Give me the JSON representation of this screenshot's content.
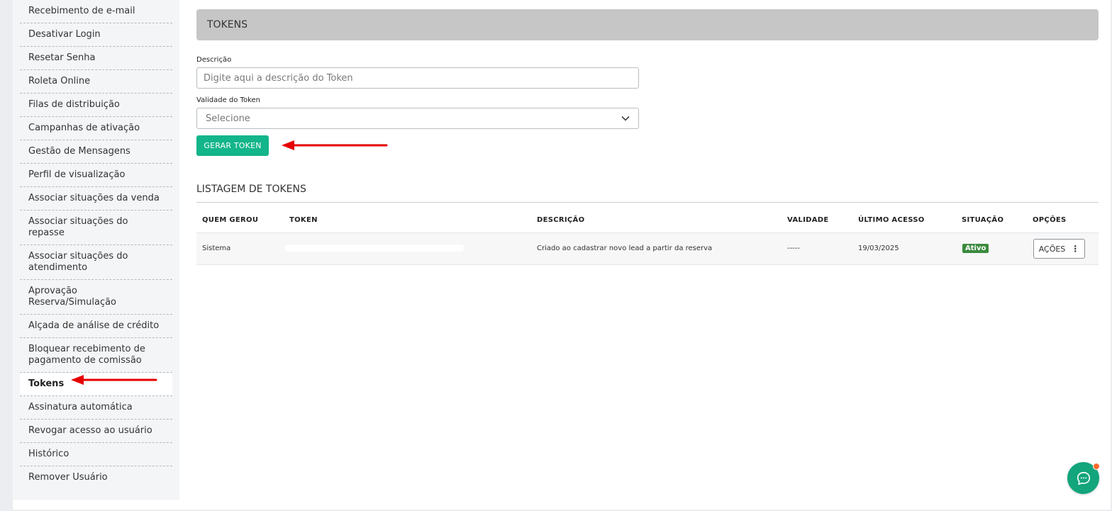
{
  "sidebar": {
    "items": [
      {
        "label": "Recebimento de e-mail",
        "active": false
      },
      {
        "label": "Desativar Login",
        "active": false
      },
      {
        "label": "Resetar Senha",
        "active": false
      },
      {
        "label": "Roleta Online",
        "active": false
      },
      {
        "label": "Filas de distribuição",
        "active": false
      },
      {
        "label": "Campanhas de ativação",
        "active": false
      },
      {
        "label": "Gestão de Mensagens",
        "active": false
      },
      {
        "label": "Perfil de visualização",
        "active": false
      },
      {
        "label": "Associar situações da venda",
        "active": false
      },
      {
        "label": "Associar situações do repasse",
        "active": false
      },
      {
        "label": "Associar situações do atendimento",
        "active": false
      },
      {
        "label": "Aprovação Reserva/Simulação",
        "active": false
      },
      {
        "label": "Alçada de análise de crédito",
        "active": false
      },
      {
        "label": "Bloquear recebimento de pagamento de comissão",
        "active": false
      },
      {
        "label": "Tokens",
        "active": true
      },
      {
        "label": "Assinatura automática",
        "active": false
      },
      {
        "label": "Revogar acesso ao usuário",
        "active": false
      },
      {
        "label": "Histórico",
        "active": false
      },
      {
        "label": "Remover Usuário",
        "active": false
      }
    ]
  },
  "header": {
    "title": "TOKENS"
  },
  "form": {
    "descricao_label": "Descrição",
    "descricao_placeholder": "Digite aqui a descrição do Token",
    "validade_label": "Validade do Token",
    "validade_selected": "Selecione",
    "gerar_button": "GERAR TOKEN"
  },
  "listing": {
    "title": "LISTAGEM DE TOKENS",
    "columns": [
      "QUEM GEROU",
      "TOKEN",
      "DESCRIÇÃO",
      "VALIDADE",
      "ÚLTIMO ACESSO",
      "SITUAÇÃO",
      "OPÇÕES"
    ],
    "rows": [
      {
        "quem_gerou": "Sistema",
        "token": "",
        "descricao": "Criado ao cadastrar novo lead a partir da reserva",
        "validade": "-----",
        "ultimo_acesso": "19/03/2025",
        "situacao": "Ativo",
        "opcoes": "AÇÕES"
      }
    ]
  },
  "colors": {
    "accent_green": "#13b58a",
    "badge_green": "#3c8a3f",
    "annotation_red": "#e60000",
    "chat_green": "#13a57c"
  }
}
